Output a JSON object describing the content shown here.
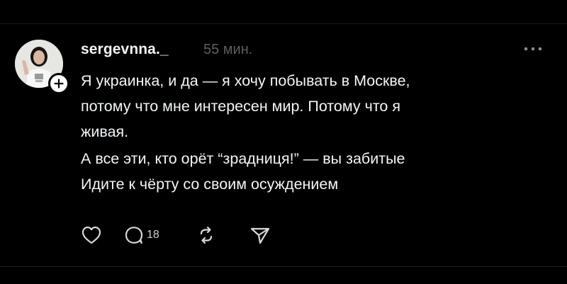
{
  "post": {
    "author": {
      "username": "sergevnna._",
      "avatar_icon": "profile-photo",
      "follow_icon": "plus-icon"
    },
    "timestamp": "55 мин.",
    "more_icon": "more-horizontal-icon",
    "text_lines": [
      "Я украинка, и да — я хочу побывать в Москве,",
      "потому что мне интересен мир. Потому что я",
      "живая.",
      "А все эти, кто орёт “зрадниця!” — вы забитые",
      "Идите к чёрту со своим осуждением"
    ],
    "actions": {
      "like_icon": "heart-icon",
      "reply_icon": "comment-icon",
      "reply_count": "18",
      "repost_icon": "repost-icon",
      "share_icon": "send-icon"
    }
  },
  "colors": {
    "background": "#000000",
    "text": "#f3f5f7",
    "secondary_text": "#5e5e5e",
    "icon": "#d8d8d8"
  }
}
